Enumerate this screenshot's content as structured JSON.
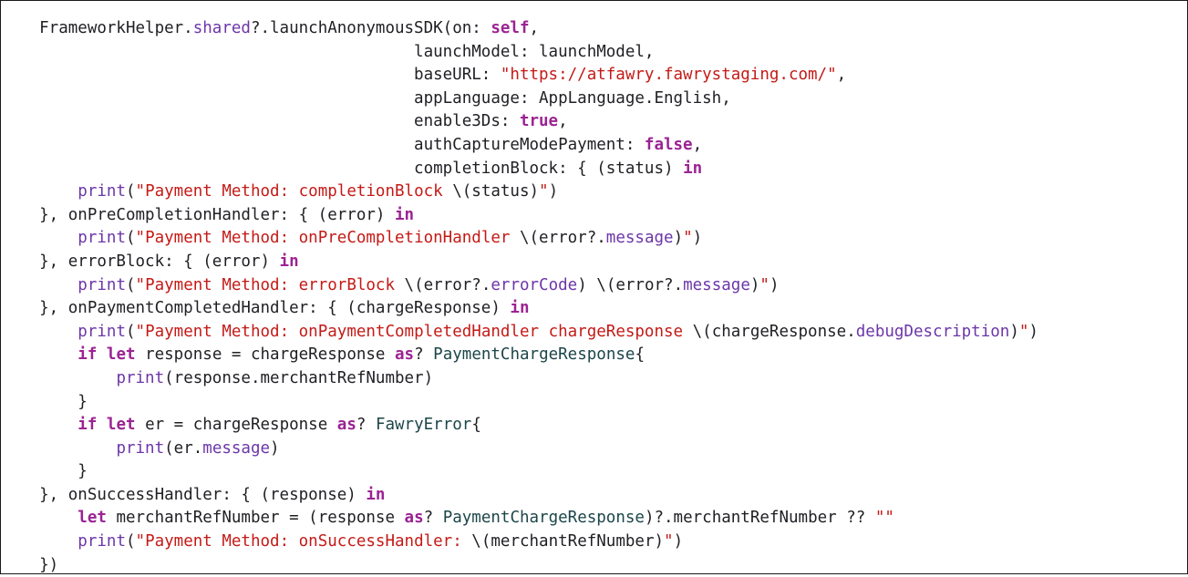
{
  "code_viewer": {
    "language": "swift",
    "colors": {
      "background": "#ffffff",
      "border": "#1a1a1a",
      "plain": "#1f1f24",
      "keyword": "#9b2393",
      "string": "#c41a16",
      "function": "#6c36a9",
      "property": "#6c36a9",
      "type": "#1c464a"
    },
    "lines": [
      {
        "tokens": [
          {
            "t": "    FrameworkHelper.",
            "k": "plain"
          },
          {
            "t": "shared",
            "k": "prop"
          },
          {
            "t": "?.launchAnonymousSDK(on: ",
            "k": "plain"
          },
          {
            "t": "self",
            "k": "keyword"
          },
          {
            "t": ",",
            "k": "plain"
          }
        ]
      },
      {
        "tokens": [
          {
            "t": "                                           launchModel: launchModel,",
            "k": "plain"
          }
        ]
      },
      {
        "tokens": [
          {
            "t": "                                           baseURL: ",
            "k": "plain"
          },
          {
            "t": "\"https://atfawry.fawrystaging.com/\"",
            "k": "string"
          },
          {
            "t": ",",
            "k": "plain"
          }
        ]
      },
      {
        "tokens": [
          {
            "t": "                                           appLanguage: AppLanguage.English,",
            "k": "plain"
          }
        ]
      },
      {
        "tokens": [
          {
            "t": "                                           enable3Ds: ",
            "k": "plain"
          },
          {
            "t": "true",
            "k": "keyword"
          },
          {
            "t": ",",
            "k": "plain"
          }
        ]
      },
      {
        "tokens": [
          {
            "t": "                                           authCaptureModePayment: ",
            "k": "plain"
          },
          {
            "t": "false",
            "k": "keyword"
          },
          {
            "t": ",",
            "k": "plain"
          }
        ]
      },
      {
        "tokens": [
          {
            "t": "                                           completionBlock: { (status) ",
            "k": "plain"
          },
          {
            "t": "in",
            "k": "keyword"
          }
        ]
      },
      {
        "tokens": [
          {
            "t": "        ",
            "k": "plain"
          },
          {
            "t": "print",
            "k": "func"
          },
          {
            "t": "(",
            "k": "plain"
          },
          {
            "t": "\"Payment Method: completionBlock ",
            "k": "string"
          },
          {
            "t": "\\(status)",
            "k": "plain"
          },
          {
            "t": "\"",
            "k": "string"
          },
          {
            "t": ")",
            "k": "plain"
          }
        ]
      },
      {
        "tokens": [
          {
            "t": "    }, onPreCompletionHandler: { (error) ",
            "k": "plain"
          },
          {
            "t": "in",
            "k": "keyword"
          }
        ]
      },
      {
        "tokens": [
          {
            "t": "        ",
            "k": "plain"
          },
          {
            "t": "print",
            "k": "func"
          },
          {
            "t": "(",
            "k": "plain"
          },
          {
            "t": "\"Payment Method: onPreCompletionHandler ",
            "k": "string"
          },
          {
            "t": "\\(error?.",
            "k": "plain"
          },
          {
            "t": "message",
            "k": "prop"
          },
          {
            "t": ")",
            "k": "plain"
          },
          {
            "t": "\"",
            "k": "string"
          },
          {
            "t": ")",
            "k": "plain"
          }
        ]
      },
      {
        "tokens": [
          {
            "t": "    }, errorBlock: { (error) ",
            "k": "plain"
          },
          {
            "t": "in",
            "k": "keyword"
          }
        ]
      },
      {
        "tokens": [
          {
            "t": "        ",
            "k": "plain"
          },
          {
            "t": "print",
            "k": "func"
          },
          {
            "t": "(",
            "k": "plain"
          },
          {
            "t": "\"Payment Method: errorBlock ",
            "k": "string"
          },
          {
            "t": "\\(error?.",
            "k": "plain"
          },
          {
            "t": "errorCode",
            "k": "prop"
          },
          {
            "t": ") ",
            "k": "plain"
          },
          {
            "t": "\\(error?.",
            "k": "plain"
          },
          {
            "t": "message",
            "k": "prop"
          },
          {
            "t": ")",
            "k": "plain"
          },
          {
            "t": "\"",
            "k": "string"
          },
          {
            "t": ")",
            "k": "plain"
          }
        ]
      },
      {
        "tokens": [
          {
            "t": "    }, onPaymentCompletedHandler: { (chargeResponse) ",
            "k": "plain"
          },
          {
            "t": "in",
            "k": "keyword"
          }
        ]
      },
      {
        "tokens": [
          {
            "t": "        ",
            "k": "plain"
          },
          {
            "t": "print",
            "k": "func"
          },
          {
            "t": "(",
            "k": "plain"
          },
          {
            "t": "\"Payment Method: onPaymentCompletedHandler chargeResponse ",
            "k": "string"
          },
          {
            "t": "\\(chargeResponse.",
            "k": "plain"
          },
          {
            "t": "debugDescription",
            "k": "prop"
          },
          {
            "t": ")",
            "k": "plain"
          },
          {
            "t": "\"",
            "k": "string"
          },
          {
            "t": ")",
            "k": "plain"
          }
        ]
      },
      {
        "tokens": [
          {
            "t": "        ",
            "k": "plain"
          },
          {
            "t": "if",
            "k": "keyword"
          },
          {
            "t": " ",
            "k": "plain"
          },
          {
            "t": "let",
            "k": "keyword"
          },
          {
            "t": " response = chargeResponse ",
            "k": "plain"
          },
          {
            "t": "as",
            "k": "keyword"
          },
          {
            "t": "? ",
            "k": "plain"
          },
          {
            "t": "PaymentChargeResponse",
            "k": "type"
          },
          {
            "t": "{",
            "k": "plain"
          }
        ]
      },
      {
        "tokens": [
          {
            "t": "            ",
            "k": "plain"
          },
          {
            "t": "print",
            "k": "func"
          },
          {
            "t": "(response.merchantRefNumber)",
            "k": "plain"
          }
        ]
      },
      {
        "tokens": [
          {
            "t": "        }",
            "k": "plain"
          }
        ]
      },
      {
        "tokens": [
          {
            "t": "        ",
            "k": "plain"
          },
          {
            "t": "if",
            "k": "keyword"
          },
          {
            "t": " ",
            "k": "plain"
          },
          {
            "t": "let",
            "k": "keyword"
          },
          {
            "t": " er = chargeResponse ",
            "k": "plain"
          },
          {
            "t": "as",
            "k": "keyword"
          },
          {
            "t": "? ",
            "k": "plain"
          },
          {
            "t": "FawryError",
            "k": "type"
          },
          {
            "t": "{",
            "k": "plain"
          }
        ]
      },
      {
        "tokens": [
          {
            "t": "            ",
            "k": "plain"
          },
          {
            "t": "print",
            "k": "func"
          },
          {
            "t": "(er.",
            "k": "plain"
          },
          {
            "t": "message",
            "k": "prop"
          },
          {
            "t": ")",
            "k": "plain"
          }
        ]
      },
      {
        "tokens": [
          {
            "t": "        }",
            "k": "plain"
          }
        ]
      },
      {
        "tokens": [
          {
            "t": "    }, onSuccessHandler: { (response) ",
            "k": "plain"
          },
          {
            "t": "in",
            "k": "keyword"
          }
        ]
      },
      {
        "tokens": [
          {
            "t": "        ",
            "k": "plain"
          },
          {
            "t": "let",
            "k": "keyword"
          },
          {
            "t": " merchantRefNumber = (response ",
            "k": "plain"
          },
          {
            "t": "as",
            "k": "keyword"
          },
          {
            "t": "? ",
            "k": "plain"
          },
          {
            "t": "PaymentChargeResponse",
            "k": "type"
          },
          {
            "t": ")?.merchantRefNumber ?? ",
            "k": "plain"
          },
          {
            "t": "\"\"",
            "k": "string"
          }
        ]
      },
      {
        "tokens": [
          {
            "t": "        ",
            "k": "plain"
          },
          {
            "t": "print",
            "k": "func"
          },
          {
            "t": "(",
            "k": "plain"
          },
          {
            "t": "\"Payment Method: onSuccessHandler: ",
            "k": "string"
          },
          {
            "t": "\\(merchantRefNumber)",
            "k": "plain"
          },
          {
            "t": "\"",
            "k": "string"
          },
          {
            "t": ")",
            "k": "plain"
          }
        ]
      },
      {
        "tokens": [
          {
            "t": "    })",
            "k": "plain"
          }
        ]
      }
    ]
  }
}
